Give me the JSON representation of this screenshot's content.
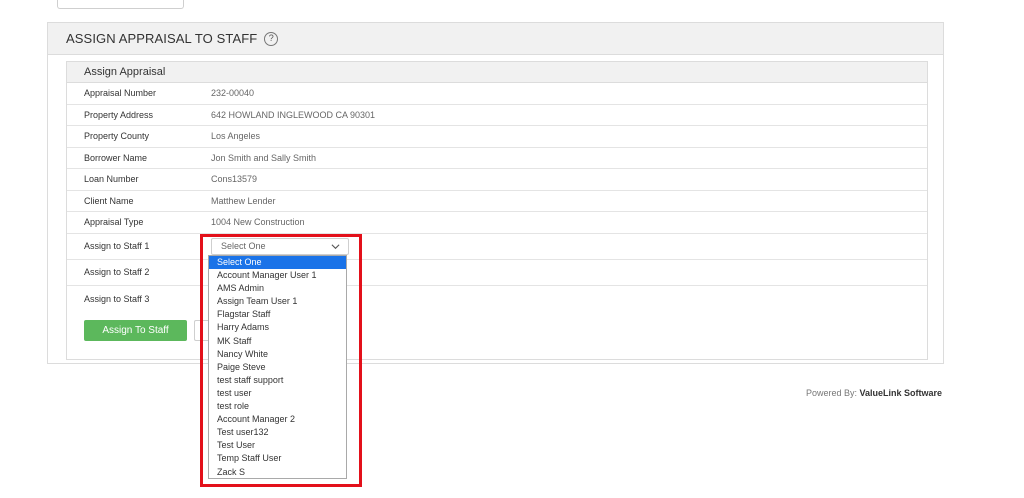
{
  "panel": {
    "title": "ASSIGN APPRAISAL TO STAFF",
    "help_icon": "question-circle-icon"
  },
  "section": {
    "title": "Assign Appraisal",
    "rows": [
      {
        "label": "Appraisal Number",
        "value": "232-00040"
      },
      {
        "label": "Property Address",
        "value": "642 HOWLAND INGLEWOOD CA 90301"
      },
      {
        "label": "Property County",
        "value": "Los Angeles"
      },
      {
        "label": "Borrower Name",
        "value": "Jon Smith and Sally Smith"
      },
      {
        "label": "Loan Number",
        "value": "Cons13579"
      },
      {
        "label": "Client Name",
        "value": "Matthew Lender"
      },
      {
        "label": "Appraisal Type",
        "value": "1004 New Construction"
      }
    ],
    "staff": [
      {
        "label": "Assign to Staff 1",
        "select_value": "Select One"
      },
      {
        "label": "Assign to Staff 2"
      },
      {
        "label": "Assign to Staff 3"
      }
    ]
  },
  "buttons": {
    "assign": "Assign To Staff"
  },
  "dropdown": {
    "selected_index": 0,
    "options": [
      "Select One",
      "Account Manager User 1",
      "AMS Admin",
      "Assign Team User 1",
      "Flagstar Staff",
      "Harry Adams",
      "MK Staff",
      "Nancy White",
      "Paige Steve",
      "test staff support",
      "test user",
      "test role",
      "Account Manager 2",
      "Test user132",
      "Test User",
      "Temp Staff User",
      "Zack S"
    ]
  },
  "footer": {
    "prefix": "Powered By: ",
    "brand": "ValueLink Software"
  },
  "colors": {
    "accent_green": "#5cb85c",
    "selected_blue": "#1a73e8",
    "highlight_red": "#e3101a"
  }
}
